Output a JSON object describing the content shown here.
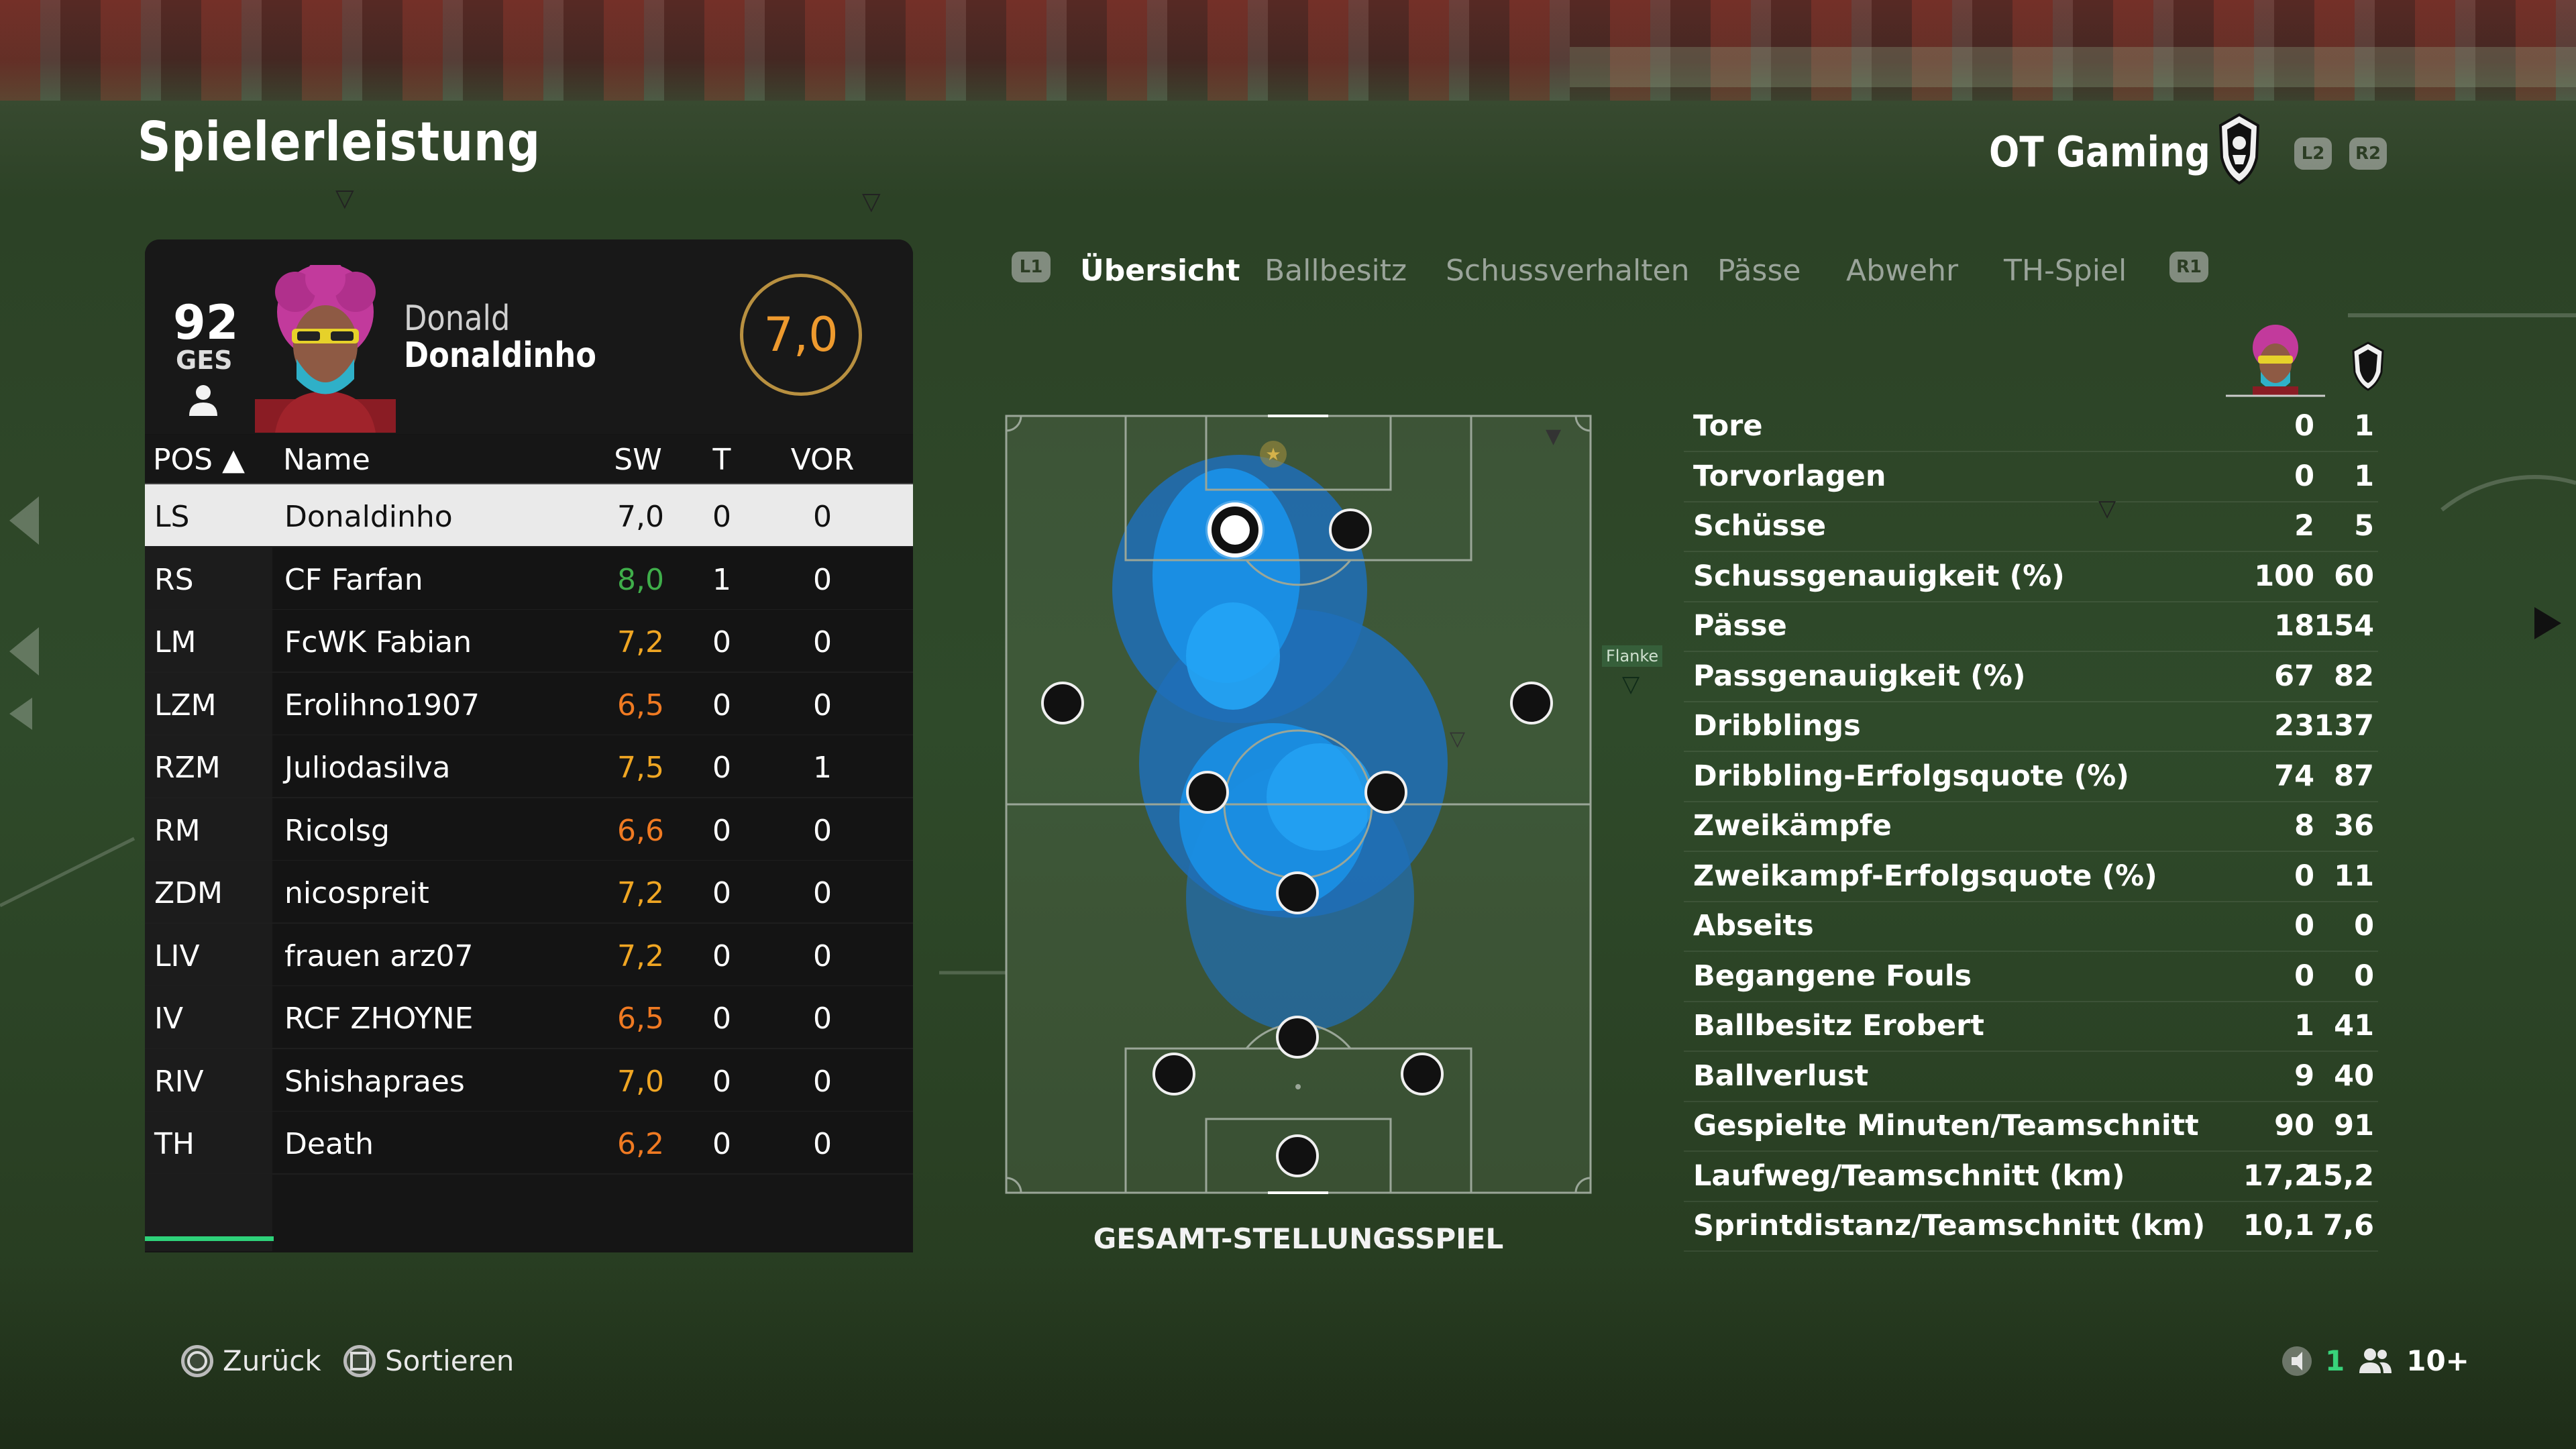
{
  "header": {
    "title": "Spielerleistung",
    "team_name": "OT Gaming",
    "l2": "L2",
    "r2": "R2"
  },
  "player": {
    "overall": "92",
    "overall_label": "GES",
    "first_name": "Donald",
    "last_name": "Donaldinho",
    "rating": "7,0"
  },
  "table": {
    "headers": {
      "pos": "POS ▲",
      "name": "Name",
      "sw": "SW",
      "t": "T",
      "vor": "VOR"
    },
    "rows": [
      {
        "pos": "LS",
        "name": "Donaldinho",
        "sw": "7,0",
        "t": "0",
        "vor": "0",
        "color": "#111111"
      },
      {
        "pos": "RS",
        "name": "CF Farfan",
        "sw": "8,0",
        "t": "1",
        "vor": "0",
        "color": "#3fae4a"
      },
      {
        "pos": "LM",
        "name": "FcWK Fabian",
        "sw": "7,2",
        "t": "0",
        "vor": "0",
        "color": "#f0a623"
      },
      {
        "pos": "LZM",
        "name": "Erolihno1907",
        "sw": "6,5",
        "t": "0",
        "vor": "0",
        "color": "#f07a22"
      },
      {
        "pos": "RZM",
        "name": "Juliodasilva",
        "sw": "7,5",
        "t": "0",
        "vor": "1",
        "color": "#f0a623"
      },
      {
        "pos": "RM",
        "name": "Ricolsg",
        "sw": "6,6",
        "t": "0",
        "vor": "0",
        "color": "#f07a22"
      },
      {
        "pos": "ZDM",
        "name": "nicospreit",
        "sw": "7,2",
        "t": "0",
        "vor": "0",
        "color": "#f0a623"
      },
      {
        "pos": "LIV",
        "name": "frauen arz07",
        "sw": "7,2",
        "t": "0",
        "vor": "0",
        "color": "#f0a623"
      },
      {
        "pos": "IV",
        "name": "RCF ZHOYNE",
        "sw": "6,5",
        "t": "0",
        "vor": "0",
        "color": "#f07a22"
      },
      {
        "pos": "RIV",
        "name": "Shishapraes",
        "sw": "7,0",
        "t": "0",
        "vor": "0",
        "color": "#f0a623"
      },
      {
        "pos": "TH",
        "name": "Death",
        "sw": "6,2",
        "t": "0",
        "vor": "0",
        "color": "#f07a22"
      }
    ]
  },
  "tabs": {
    "l1": "L1",
    "r1": "R1",
    "items": [
      {
        "label": "Übersicht",
        "active": true
      },
      {
        "label": "Ballbesitz",
        "active": false
      },
      {
        "label": "Schussverhalten",
        "active": false
      },
      {
        "label": "Pässe",
        "active": false
      },
      {
        "label": "Abwehr",
        "active": false
      },
      {
        "label": "TH-Spiel",
        "active": false
      }
    ]
  },
  "pitch": {
    "caption": "GESAMT-STELLUNGSSPIEL",
    "flank_label": "Flanke"
  },
  "stats": [
    {
      "label": "Tore",
      "player": "0",
      "team": "1"
    },
    {
      "label": "Torvorlagen",
      "player": "0",
      "team": "1"
    },
    {
      "label": "Schüsse",
      "player": "2",
      "team": "5"
    },
    {
      "label": "Schussgenauigkeit (%)",
      "player": "100",
      "team": "60"
    },
    {
      "label": "Pässe",
      "player": "18",
      "team": "154"
    },
    {
      "label": "Passgenauigkeit (%)",
      "player": "67",
      "team": "82"
    },
    {
      "label": "Dribblings",
      "player": "23",
      "team": "137"
    },
    {
      "label": "Dribbling-Erfolgsquote (%)",
      "player": "74",
      "team": "87"
    },
    {
      "label": "Zweikämpfe",
      "player": "8",
      "team": "36"
    },
    {
      "label": "Zweikampf-Erfolgsquote (%)",
      "player": "0",
      "team": "11"
    },
    {
      "label": "Abseits",
      "player": "0",
      "team": "0"
    },
    {
      "label": "Begangene Fouls",
      "player": "0",
      "team": "0"
    },
    {
      "label": "Ballbesitz Erobert",
      "player": "1",
      "team": "41"
    },
    {
      "label": "Ballverlust",
      "player": "9",
      "team": "40"
    },
    {
      "label": "Gespielte Minuten/Teamschnitt",
      "player": "90",
      "team": "91"
    },
    {
      "label": "Laufweg/Teamschnitt (km)",
      "player": "17,2",
      "team": "15,2"
    },
    {
      "label": "Sprintdistanz/Teamschnitt (km)",
      "player": "10,1",
      "team": "7,6"
    }
  ],
  "footer": {
    "back": "Zurück",
    "sort": "Sortieren",
    "count": "1",
    "players": "10+"
  },
  "icons": {
    "back_button": "circle-button-icon",
    "sort_button": "square-button-icon",
    "mic": "mic-muted-icon",
    "group": "players-group-icon"
  }
}
